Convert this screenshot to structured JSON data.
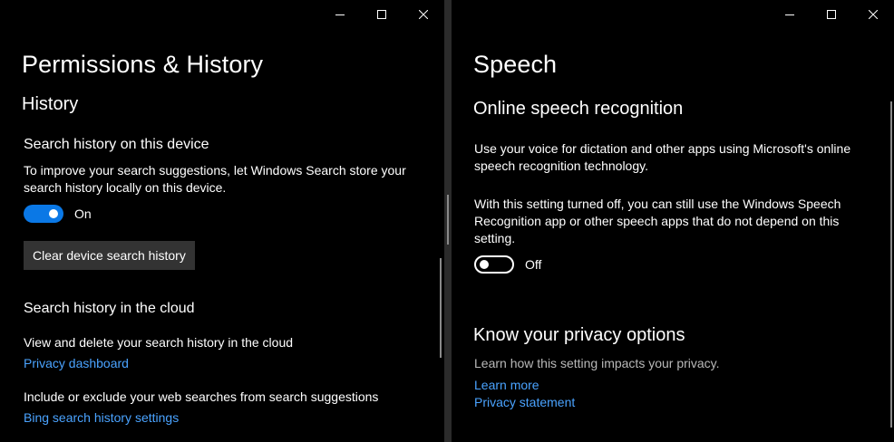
{
  "left": {
    "page_title": "Permissions & History",
    "section_title": "History",
    "device": {
      "heading": "Search history on this device",
      "description": "To improve your search suggestions, let Windows Search store your search history locally on this device.",
      "toggle_state": "On",
      "clear_button": "Clear device search history"
    },
    "cloud": {
      "heading": "Search history in the cloud",
      "view_text": "View and delete your search history in the cloud",
      "privacy_link": "Privacy dashboard",
      "include_text": "Include or exclude your web searches from search suggestions",
      "bing_link": "Bing search history settings"
    }
  },
  "right": {
    "page_title": "Speech",
    "section_title": "Online speech recognition",
    "description": "Use your voice for dictation and other apps using Microsoft's online speech recognition technology.",
    "off_note": "With this setting turned off, you can still use the Windows Speech Recognition app or other speech apps that do not depend on this setting.",
    "toggle_state": "Off",
    "privacy": {
      "heading": "Know your privacy options",
      "description": "Learn how this setting impacts your privacy.",
      "learn_more": "Learn more",
      "privacy_statement": "Privacy statement"
    }
  },
  "colors": {
    "background": "#000000",
    "accent": "#0a78e6",
    "link": "#4aa3ff",
    "button": "#333333"
  }
}
